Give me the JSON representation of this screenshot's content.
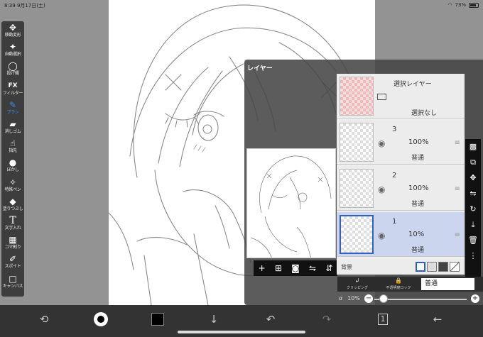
{
  "status_bar": {
    "time": "8:39",
    "date": "9月17日(土)",
    "battery": "73%",
    "wifi_icon": "wifi-icon"
  },
  "left_toolbar": {
    "tools": [
      {
        "icon": "move-transform-icon",
        "glyph": "✥",
        "label": "移動変形"
      },
      {
        "icon": "magic-wand-icon",
        "glyph": "✦",
        "label": "自動選択"
      },
      {
        "icon": "lasso-icon",
        "glyph": "◯",
        "label": "投げ縄"
      },
      {
        "icon": "fx-icon",
        "glyph": "FX",
        "label": "フィルター"
      },
      {
        "icon": "brush-icon",
        "glyph": "✎",
        "label": "ブラシ",
        "active": true
      },
      {
        "icon": "eraser-icon",
        "glyph": "▰",
        "label": "消しゴム"
      },
      {
        "icon": "finger-icon",
        "glyph": "☝",
        "label": "指先"
      },
      {
        "icon": "blur-icon",
        "glyph": "●",
        "label": "ぼかし"
      },
      {
        "icon": "special-pen-icon",
        "glyph": "✧",
        "label": "特殊ペン"
      },
      {
        "icon": "fill-icon",
        "glyph": "◆",
        "label": "塗りつぶし"
      },
      {
        "icon": "text-icon",
        "glyph": "T",
        "label": "文字入れ"
      },
      {
        "icon": "frame-icon",
        "glyph": "▦",
        "label": "コマ割り"
      },
      {
        "icon": "eyedropper-icon",
        "glyph": "✐",
        "label": "スポイト"
      },
      {
        "icon": "canvas-icon",
        "glyph": "□",
        "label": "キャンバス"
      }
    ]
  },
  "layer_panel": {
    "title": "レイヤー",
    "selection_layer": {
      "title": "選択レイヤー",
      "status": "選択なし"
    },
    "layers": [
      {
        "number": "3",
        "opacity": "100%",
        "blend": "普通",
        "selected": false
      },
      {
        "number": "2",
        "opacity": "100%",
        "blend": "普通",
        "selected": false
      },
      {
        "number": "1",
        "opacity": "10%",
        "blend": "普通",
        "selected": true
      }
    ],
    "background_label": "背景",
    "clipping_label": "クリッピング",
    "alpha_lock_label": "不透明度ロック",
    "blend_mode": "普通",
    "alpha_symbol": "α",
    "alpha_value": "10%",
    "alpha_level": 0.1
  }
}
